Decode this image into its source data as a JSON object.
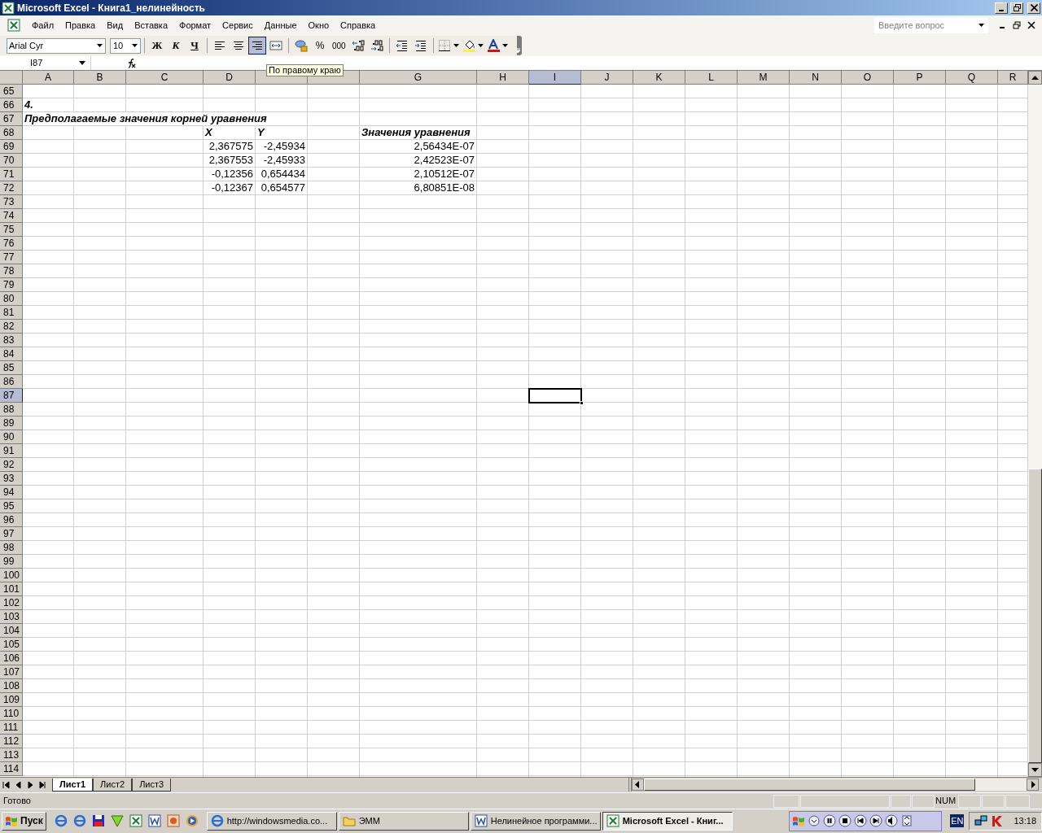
{
  "window": {
    "title": "Microsoft Excel - Книга1_нелинейность"
  },
  "menu": [
    "Файл",
    "Правка",
    "Вид",
    "Вставка",
    "Формат",
    "Сервис",
    "Данные",
    "Окно",
    "Справка"
  ],
  "help_search": {
    "placeholder": "Введите вопрос"
  },
  "toolbar": {
    "font": "Arial Cyr",
    "size": "10",
    "buttons": [
      {
        "kind": "bold",
        "label": "Ж",
        "pressed": false
      },
      {
        "kind": "italic",
        "label": "К",
        "pressed": false
      },
      {
        "kind": "underline",
        "label": "Ч",
        "pressed": false
      },
      {
        "kind": "align-left",
        "pressed": false
      },
      {
        "kind": "align-center",
        "pressed": false
      },
      {
        "kind": "align-right",
        "pressed": true
      },
      {
        "kind": "merge",
        "pressed": false
      },
      {
        "kind": "currency",
        "pressed": false
      },
      {
        "kind": "percent",
        "label": "%",
        "pressed": false
      },
      {
        "kind": "thousands",
        "label": "000",
        "pressed": false
      },
      {
        "kind": "increase-decimal",
        "pressed": false
      },
      {
        "kind": "decrease-decimal",
        "pressed": false
      },
      {
        "kind": "outdent",
        "pressed": false
      },
      {
        "kind": "indent",
        "pressed": false
      },
      {
        "kind": "borders",
        "pressed": false
      },
      {
        "kind": "fill-color",
        "pressed": false
      },
      {
        "kind": "font-color",
        "pressed": false
      }
    ]
  },
  "name_box": "I87",
  "tooltip": "По правому краю",
  "columns": [
    {
      "label": "A",
      "selected": false
    },
    {
      "label": "B",
      "selected": false
    },
    {
      "label": "C",
      "selected": false
    },
    {
      "label": "D",
      "selected": false
    },
    {
      "selected": false
    },
    {
      "selected": false
    },
    {
      "label": "G",
      "selected": false
    },
    {
      "label": "H",
      "selected": false
    },
    {
      "label": "I",
      "selected": true
    },
    {
      "label": "J",
      "selected": false
    },
    {
      "label": "K",
      "selected": false
    },
    {
      "label": "L",
      "selected": false
    },
    {
      "label": "M",
      "selected": false
    },
    {
      "label": "N",
      "selected": false
    },
    {
      "label": "O",
      "selected": false
    },
    {
      "label": "P",
      "selected": false
    },
    {
      "label": "Q",
      "selected": false
    },
    {
      "label": "R",
      "selected": false
    }
  ],
  "rows": [
    {
      "number": "65",
      "selected": false
    },
    {
      "number": "66",
      "selected": false,
      "kind": "heading",
      "a": "4."
    },
    {
      "number": "67",
      "selected": false,
      "kind": "heading",
      "a": "Предполагаемые значения корней уравнения"
    },
    {
      "number": "68",
      "selected": false,
      "kind": "heading",
      "d": "X",
      "e": "Y",
      "g": "Значения уравнения"
    },
    {
      "number": "69",
      "selected": false,
      "kind": "number",
      "d": "2,367575",
      "e": "-2,45934",
      "g": "2,56434E-07"
    },
    {
      "number": "70",
      "selected": false,
      "kind": "number",
      "d": "2,367553",
      "e": "-2,45933",
      "g": "2,42523E-07"
    },
    {
      "number": "71",
      "selected": false,
      "kind": "number",
      "d": "-0,12356",
      "e": "0,654434",
      "g": "2,10512E-07"
    },
    {
      "number": "72",
      "selected": false,
      "kind": "number",
      "d": "-0,12367",
      "e": "0,654577",
      "g": "6,80851E-08"
    },
    {
      "number": "73",
      "selected": false
    },
    {
      "number": "74",
      "selected": false
    },
    {
      "number": "75",
      "selected": false
    },
    {
      "number": "76",
      "selected": false
    },
    {
      "number": "77",
      "selected": false
    },
    {
      "number": "78",
      "selected": false
    },
    {
      "number": "79",
      "selected": false
    },
    {
      "number": "80",
      "selected": false
    },
    {
      "number": "81",
      "selected": false
    },
    {
      "number": "82",
      "selected": false
    },
    {
      "number": "83",
      "selected": false
    },
    {
      "number": "84",
      "selected": false
    },
    {
      "number": "85",
      "selected": false
    },
    {
      "number": "86",
      "selected": false
    },
    {
      "number": "87",
      "selected": true
    },
    {
      "number": "88",
      "selected": false
    },
    {
      "number": "89",
      "selected": false
    },
    {
      "number": "90",
      "selected": false
    },
    {
      "number": "91",
      "selected": false
    },
    {
      "number": "92",
      "selected": false
    },
    {
      "number": "93",
      "selected": false
    },
    {
      "number": "94",
      "selected": false
    },
    {
      "number": "95",
      "selected": false
    },
    {
      "number": "96",
      "selected": false
    },
    {
      "number": "97",
      "selected": false
    },
    {
      "number": "98",
      "selected": false
    },
    {
      "number": "99",
      "selected": false
    },
    {
      "number": "100",
      "selected": false
    },
    {
      "number": "101",
      "selected": false
    },
    {
      "number": "102",
      "selected": false
    },
    {
      "number": "103",
      "selected": false
    },
    {
      "number": "104",
      "selected": false
    },
    {
      "number": "105",
      "selected": false
    },
    {
      "number": "106",
      "selected": false
    },
    {
      "number": "107",
      "selected": false
    },
    {
      "number": "108",
      "selected": false
    },
    {
      "number": "109",
      "selected": false
    },
    {
      "number": "110",
      "selected": false
    },
    {
      "number": "111",
      "selected": false
    },
    {
      "number": "112",
      "selected": false
    },
    {
      "number": "113",
      "selected": false
    },
    {
      "number": "114",
      "selected": false
    }
  ],
  "sheet_tabs": [
    {
      "label": "Лист1",
      "selected": true
    },
    {
      "label": "Лист2",
      "selected": false
    },
    {
      "label": "Лист3",
      "selected": false
    }
  ],
  "status_bar": {
    "text": "Готово",
    "indicator": "NUM"
  },
  "taskbar": {
    "start": "Пуск",
    "quick_launch": [
      {
        "kind": "browser"
      },
      {
        "kind": "browser"
      },
      {
        "kind": "disk"
      },
      {
        "kind": "v"
      },
      {
        "kind": "excel"
      },
      {
        "kind": "word"
      },
      {
        "kind": "presentation"
      },
      {
        "kind": "player"
      }
    ],
    "tasks": [
      {
        "label": "http://windowsmedia.co...",
        "kind": "browser",
        "selected": false
      },
      {
        "label": "ЭММ",
        "kind": "folder",
        "selected": false
      },
      {
        "label": "Нелинейное программи...",
        "kind": "word",
        "selected": false
      },
      {
        "label": "Microsoft Excel - Книг...",
        "kind": "excel",
        "selected": true
      }
    ],
    "language": "EN",
    "clock": "13:18"
  }
}
